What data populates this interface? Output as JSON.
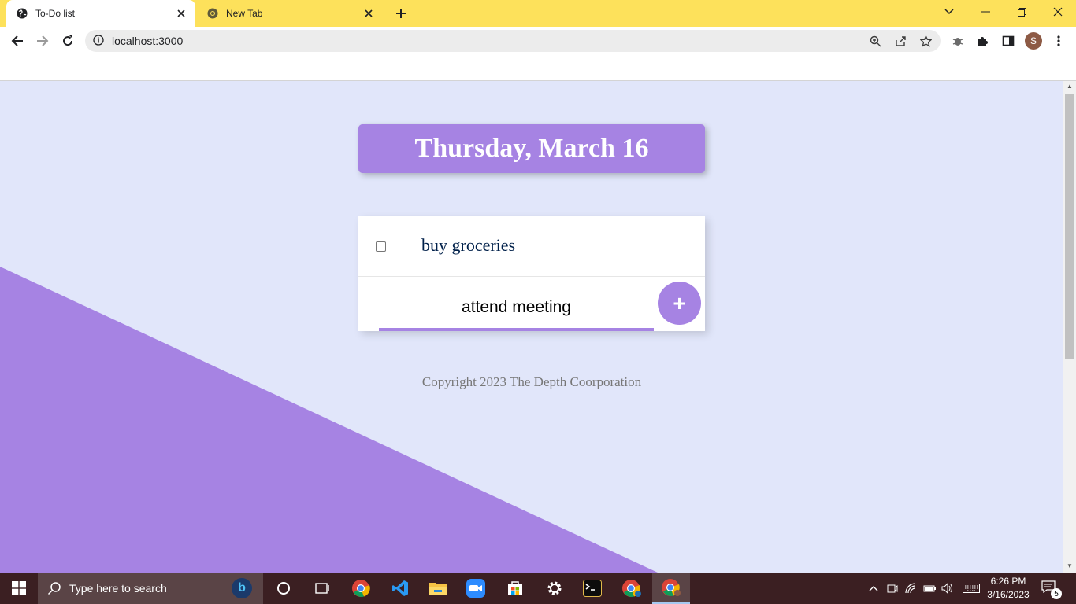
{
  "browser": {
    "tabs": [
      {
        "title": "To-Do list",
        "active": true,
        "icon": "globe-icon"
      },
      {
        "title": "New Tab",
        "active": false,
        "icon": "chrome-icon"
      }
    ],
    "url": "localhost:3000",
    "profile_initial": "S",
    "tabstrip_color": "#fde15b"
  },
  "page": {
    "date_heading": "Thursday, March 16",
    "items": [
      {
        "text": "buy groceries",
        "checked": false
      }
    ],
    "new_item_value": "attend meeting",
    "add_button_label": "+",
    "footer": "Copyright 2023 The Depth Coorporation",
    "accent_color": "#a683e3",
    "background_color": "#e1e6fa"
  },
  "taskbar": {
    "search_placeholder": "Type here to search",
    "time": "6:26 PM",
    "date": "3/16/2023",
    "notification_count": "5",
    "apps": [
      "cortana-icon",
      "task-view-icon",
      "chrome-icon",
      "vscode-icon",
      "file-explorer-icon",
      "zoom-icon",
      "microsoft-store-icon",
      "settings-icon",
      "terminal-icon",
      "chrome-profile-icon",
      "chrome-active-icon"
    ]
  }
}
